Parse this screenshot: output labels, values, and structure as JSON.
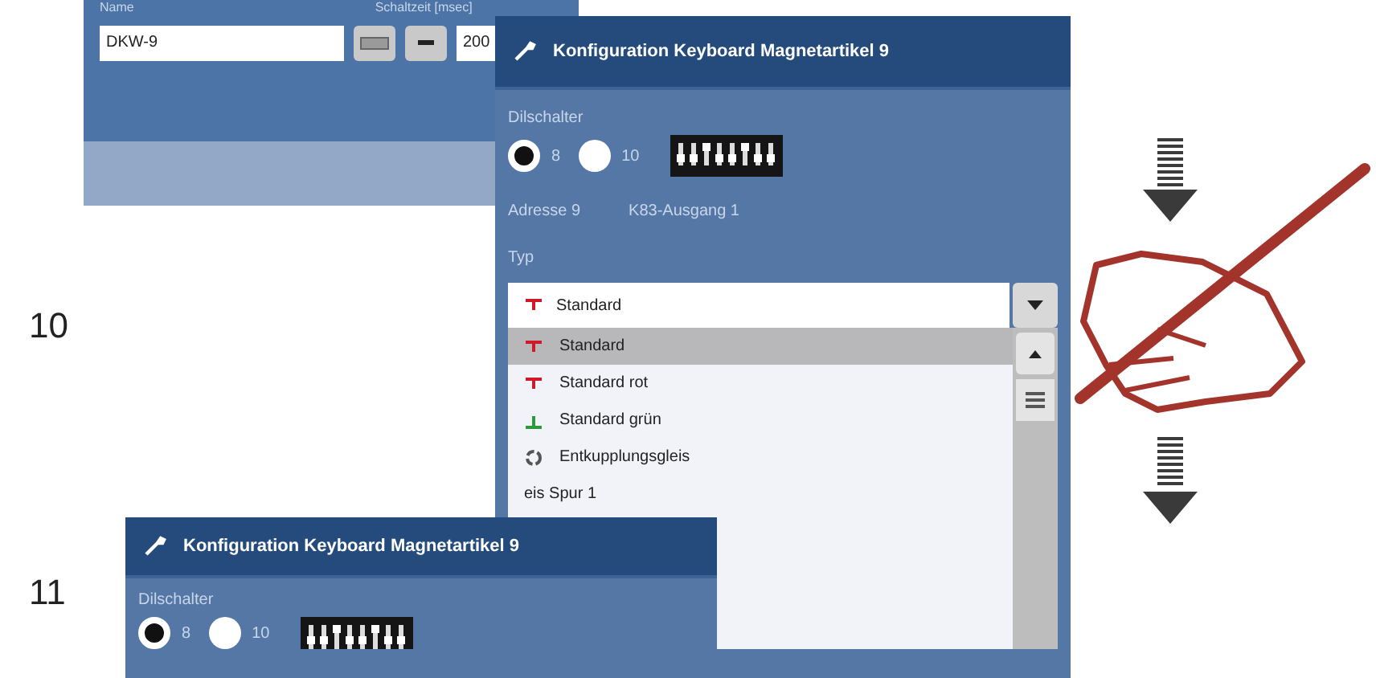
{
  "steps": [
    {
      "number": "10"
    },
    {
      "number": "11"
    }
  ],
  "name_panel": {
    "name_label": "Name",
    "time_label": "Schaltzeit [msec]",
    "name_value": "DKW-9",
    "time_value": "200"
  },
  "config_dialog": {
    "title": "Konfiguration Keyboard Magnetartikel 9",
    "dip_label": "Dilschalter",
    "dip_options": [
      {
        "label": "8",
        "selected": true
      },
      {
        "label": "10",
        "selected": false
      }
    ],
    "address": "Adresse 9",
    "output": "K83-Ausgang 1",
    "type_label": "Typ",
    "type_value": {
      "label": "Standard",
      "kind": "red"
    },
    "type_options": [
      {
        "label": "Standard",
        "kind": "red",
        "selected": true
      },
      {
        "label": "Standard rot",
        "kind": "red",
        "selected": false
      },
      {
        "label": "Standard grün",
        "kind": "green",
        "selected": false
      },
      {
        "label": "Entkupplungsgleis",
        "kind": "uncouple",
        "selected": false
      },
      {
        "label": "eis Spur 1",
        "kind": "none",
        "selected": false
      }
    ]
  },
  "config_dialog_2": {
    "title": "Konfiguration Keyboard Magnetartikel 9",
    "dip_label": "Dilschalter",
    "dip_options": [
      {
        "label": "8",
        "selected": true
      },
      {
        "label": "10",
        "selected": false
      }
    ]
  }
}
